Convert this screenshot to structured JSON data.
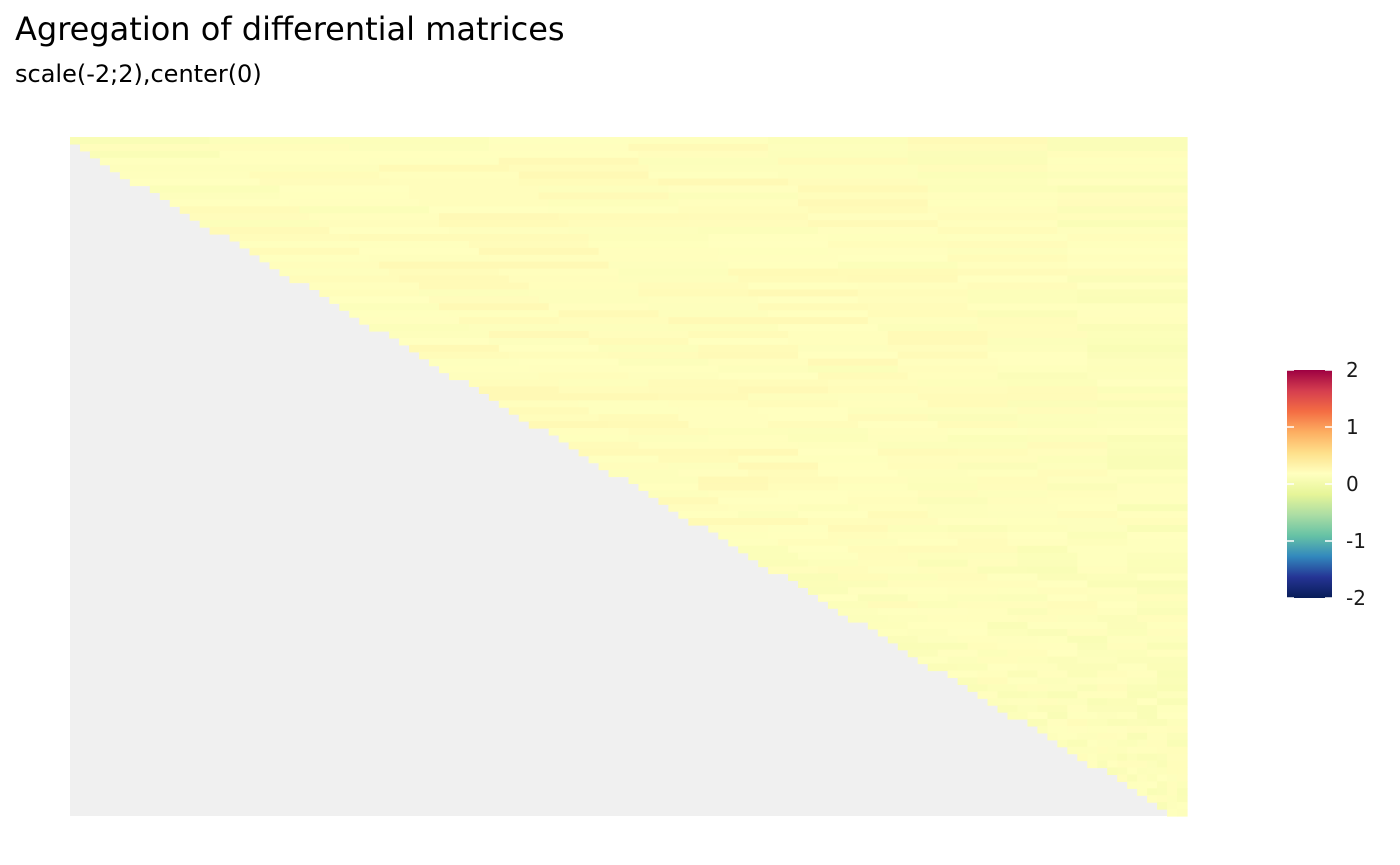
{
  "chart_data": {
    "type": "heatmap",
    "title": "Agregation of differential matrices",
    "subtitle": "scale(-2;2),center(0)",
    "matrix": {
      "shape": "upper-triangle",
      "columns": 112,
      "rows": 98,
      "value_range_observed": [
        0.0,
        0.25
      ],
      "typical_value": 0.15,
      "lower_triangle": "NA"
    },
    "colorbar": {
      "limits": [
        -2,
        2
      ],
      "center": 0,
      "ticks": [
        2,
        1,
        0,
        -1,
        -2
      ],
      "tick_labels": [
        "2",
        "1",
        "0",
        "-1",
        "-2"
      ],
      "palette": [
        "#9e0142",
        "#d53e4f",
        "#f46d43",
        "#fdae61",
        "#fee08b",
        "#ffffbf",
        "#e6f598",
        "#abdda4",
        "#66c2a5",
        "#3288bd",
        "#253494",
        "#081d58"
      ]
    },
    "colors": {
      "na_fill": "#f0f0f0",
      "background": "#ffffff"
    },
    "legend_position": "right",
    "axes_visible": false,
    "grid": false
  }
}
